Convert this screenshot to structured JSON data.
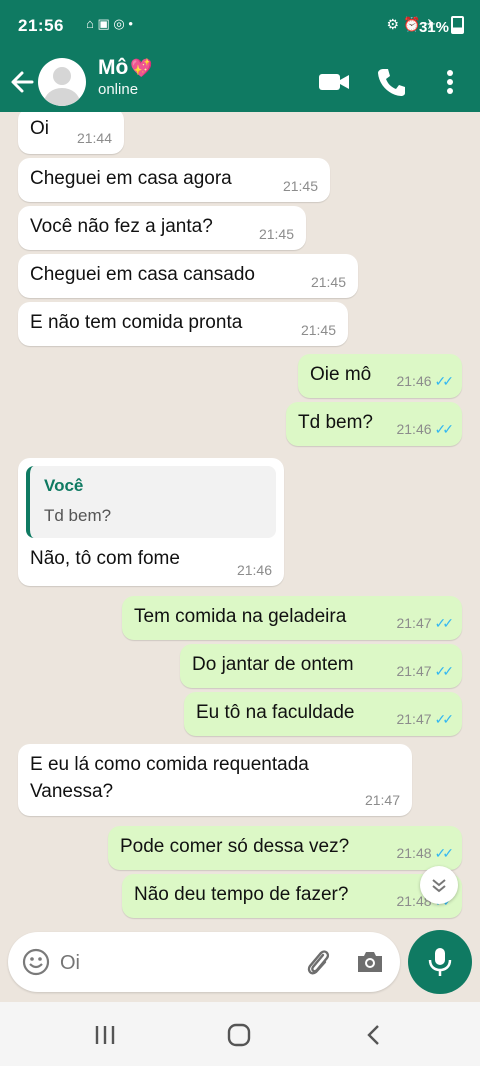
{
  "status_bar": {
    "time": "21:56",
    "battery": "31%"
  },
  "header": {
    "contact_name": "Mô",
    "contact_emoji": "💖",
    "contact_status": "online"
  },
  "messages": [
    {
      "dir": "in",
      "text": "Oi",
      "time": "21:44"
    },
    {
      "dir": "in",
      "text": "Cheguei em casa agora",
      "time": "21:45"
    },
    {
      "dir": "in",
      "text": "Você não fez a janta?",
      "time": "21:45"
    },
    {
      "dir": "in",
      "text": "Cheguei em casa cansado",
      "time": "21:45"
    },
    {
      "dir": "in",
      "text": "E não tem comida pronta",
      "time": "21:45"
    },
    {
      "dir": "out",
      "text": "Oie mô",
      "time": "21:46",
      "read": true
    },
    {
      "dir": "out",
      "text": "Td bem?",
      "time": "21:46",
      "read": true
    },
    {
      "dir": "in",
      "text": "Não, tô com fome",
      "time": "21:46",
      "quote_author": "Você",
      "quote_text": "Td bem?"
    },
    {
      "dir": "out",
      "text": "Tem comida na geladeira",
      "time": "21:47",
      "read": true
    },
    {
      "dir": "out",
      "text": "Do jantar de ontem",
      "time": "21:47",
      "read": true
    },
    {
      "dir": "out",
      "text": "Eu tô na faculdade",
      "time": "21:47",
      "read": true
    },
    {
      "dir": "in",
      "text": "E eu lá como comida requentada",
      "text2": "Vanessa?",
      "time": "21:47"
    },
    {
      "dir": "out",
      "text": "Pode comer só dessa vez?",
      "time": "21:48",
      "read": true
    },
    {
      "dir": "out",
      "text": "Não deu tempo de fazer?",
      "time": "21:48",
      "read": true
    }
  ],
  "composer": {
    "placeholder": "Oi"
  },
  "colors": {
    "header_bg": "#0f7a62",
    "outgoing_bubble": "#dcf8c6",
    "incoming_bubble": "#ffffff",
    "read_ticks": "#34b7f1",
    "chat_bg": "#ece5dd"
  },
  "icons": [
    "back-arrow-icon",
    "video-call-icon",
    "phone-icon",
    "more-vert-icon",
    "emoji-icon",
    "attach-icon",
    "camera-icon",
    "mic-icon",
    "scroll-down-icon"
  ]
}
